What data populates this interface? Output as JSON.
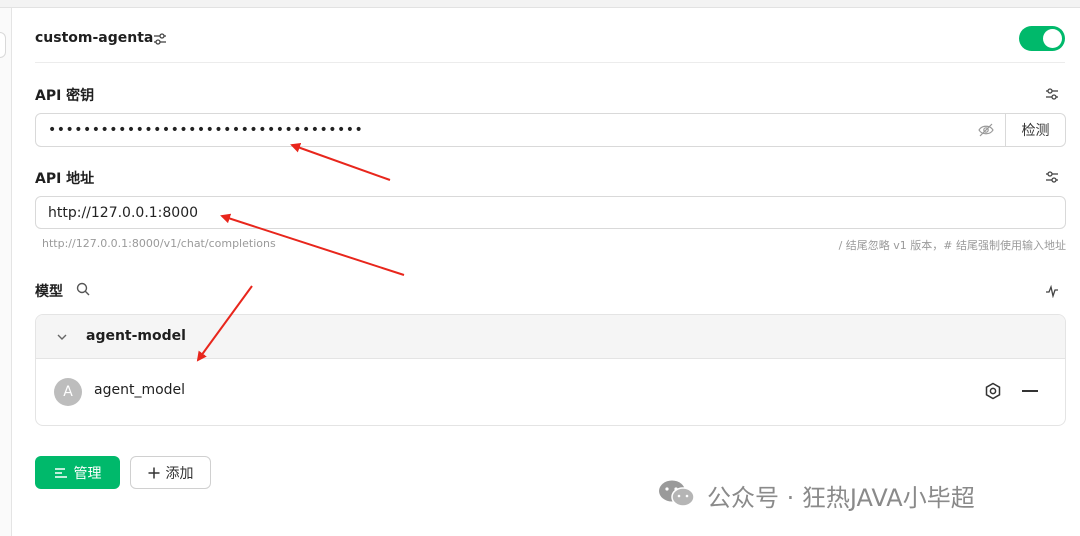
{
  "provider": {
    "name": "custom-agenta",
    "enabled": true
  },
  "api_key": {
    "label": "API 密钥",
    "value": "••••••••••••••••••••••••••••••••••••",
    "check_label": "检测"
  },
  "api_url": {
    "label": "API 地址",
    "value": "http://127.0.0.1:8000",
    "hint_left": "http://127.0.0.1:8000/v1/chat/completions",
    "hint_right": "/ 结尾忽略 v1 版本，# 结尾强制使用输入地址"
  },
  "models": {
    "label": "模型",
    "groups": [
      {
        "title": "agent-model",
        "items": [
          {
            "avatar": "A",
            "name": "agent_model"
          }
        ]
      }
    ]
  },
  "actions": {
    "manage_label": "管理",
    "add_label": "添加"
  },
  "watermark": {
    "text": "公众号 · 狂热JAVA小毕超"
  },
  "colors": {
    "accent": "#00b96b",
    "annotation_arrow": "#e8261c"
  },
  "icons": {
    "provider_settings": "sliders-icon",
    "eye_off": "eye-off-icon",
    "search": "search-icon",
    "chevron": "chevron-down-icon",
    "model_settings": "hexagon-settings-icon",
    "remove": "minus-icon",
    "manage": "list-icon",
    "add": "plus-icon"
  }
}
